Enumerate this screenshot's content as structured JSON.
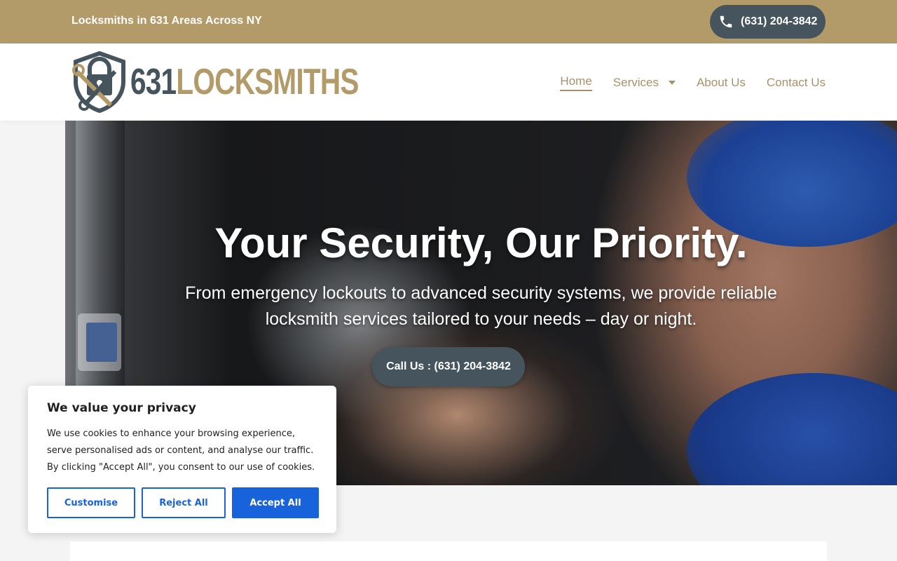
{
  "topbar": {
    "tagline": "Locksmiths in 631 Areas Across NY",
    "phone": "(631) 204-3842"
  },
  "header": {
    "logo": {
      "number": "631",
      "word": "LOCKSMITHS"
    },
    "nav": {
      "home": "Home",
      "services": "Services",
      "about": "About Us",
      "contact": "Contact Us"
    }
  },
  "hero": {
    "title": "Your Security, Our Priority.",
    "subtitle_line1": "From emergency lockouts to advanced security systems, we provide reliable",
    "subtitle_line2": "locksmith services tailored to your needs – day or night.",
    "cta": "Call Us : (631) 204-3842"
  },
  "cookie": {
    "title": "We value your privacy",
    "text": "We use cookies to enhance your browsing experience, serve personalised ads or content, and analyse our traffic. By clicking \"Accept All\", you consent to our use of cookies.",
    "customise": "Customise",
    "reject": "Reject All",
    "accept": "Accept All"
  },
  "colors": {
    "gold": "#b39b69",
    "slate": "#45545d",
    "cookie_blue": "#1863dc"
  },
  "icons": [
    "phone-icon",
    "padlock-keys-logo-icon",
    "chevron-down-icon"
  ]
}
